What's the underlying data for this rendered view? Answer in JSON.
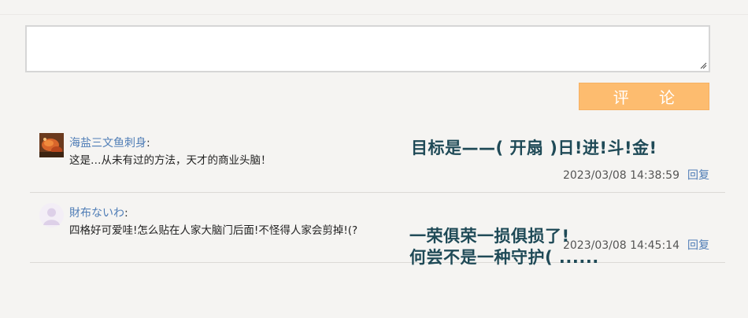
{
  "comment_input": {
    "value": "",
    "placeholder": ""
  },
  "submit_button": {
    "chars": [
      "评",
      "论"
    ]
  },
  "comments": [
    {
      "user": "海盐三文鱼刺身",
      "text": "这是…从未有过的方法，天才的商业头脑！",
      "timestamp": "2023/03/08 14:38:59",
      "reply_label": "回复",
      "avatar": "food-photo-avatar"
    },
    {
      "user": "財布ないわ",
      "text": "四格好可爱哇!怎么贴在人家大脑门后面!不怪得人家会剪掉!(?",
      "timestamp": "2023/03/08 14:45:14",
      "reply_label": "回复",
      "avatar": "default-avatar"
    }
  ],
  "danmaku": [
    {
      "text": "目标是——( 开扇 )日!进!斗!金!"
    },
    {
      "text": "一荣俱荣一损俱损了!\n何尝不是一种守护( ......"
    }
  ],
  "colors": {
    "accent": "#fdbc6f",
    "link": "#4f7db6",
    "danmaku": "#1f4a57",
    "background": "#f5f4f2"
  }
}
